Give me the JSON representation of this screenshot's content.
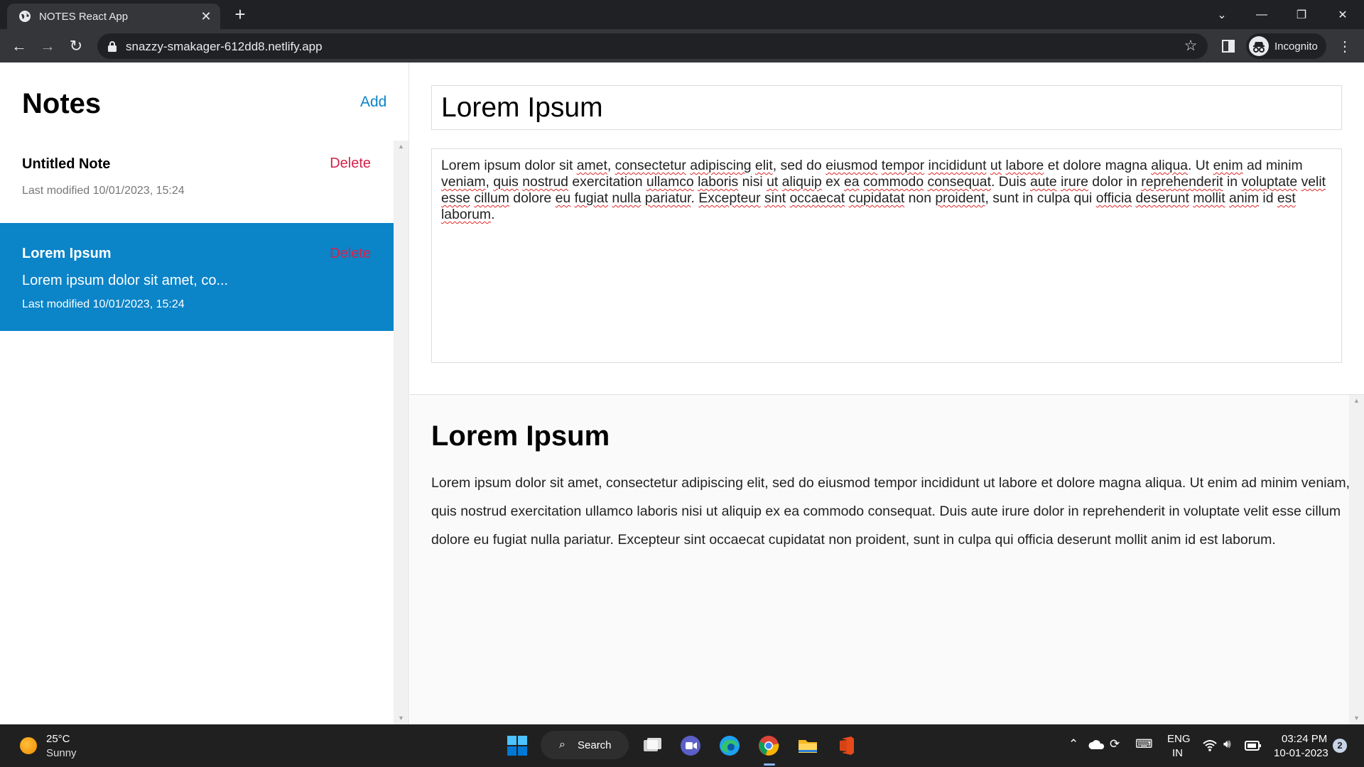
{
  "browser": {
    "tab_title": "NOTES React App",
    "url": "snazzy-smakager-612dd8.netlify.app",
    "profile_label": "Incognito"
  },
  "sidebar": {
    "title": "Notes",
    "add_label": "Add",
    "notes": [
      {
        "title": "Untitled Note",
        "delete_label": "Delete",
        "preview": "",
        "modified": "Last modified 10/01/2023, 15:24",
        "active": false
      },
      {
        "title": "Lorem Ipsum",
        "delete_label": "Delete",
        "preview": "Lorem ipsum dolor sit amet, co...",
        "modified": "Last modified 10/01/2023, 15:24",
        "active": true
      }
    ]
  },
  "editor": {
    "title_value": "Lorem Ipsum",
    "body_value": "Lorem ipsum dolor sit amet, consectetur adipiscing elit, sed do eiusmod tempor incididunt ut labore et dolore magna aliqua. Ut enim ad minim veniam, quis nostrud exercitation ullamco laboris nisi ut aliquip ex ea commodo consequat. Duis aute irure dolor in reprehenderit in voluptate velit esse cillum dolore eu fugiat nulla pariatur. Excepteur sint occaecat cupidatat non proident, sunt in culpa qui officia deserunt mollit anim id est laborum."
  },
  "preview": {
    "title": "Lorem Ipsum",
    "body": "Lorem ipsum dolor sit amet, consectetur adipiscing elit, sed do eiusmod tempor incididunt ut labore et dolore magna aliqua. Ut enim ad minim veniam, quis nostrud exercitation ullamco laboris nisi ut aliquip ex ea commodo consequat. Duis aute irure dolor in reprehenderit in voluptate velit esse cillum dolore eu fugiat nulla pariatur. Excepteur sint occaecat cupidatat non proident, sunt in culpa qui officia deserunt mollit anim id est laborum."
  },
  "taskbar": {
    "weather_temp": "25°C",
    "weather_desc": "Sunny",
    "search_label": "Search",
    "lang_line1": "ENG",
    "lang_line2": "IN",
    "time": "03:24 PM",
    "date": "10-01-2023",
    "notification_count": "2"
  },
  "colors": {
    "accent": "#0b84c8",
    "delete": "#d6224b",
    "chrome_dark": "#202124",
    "chrome_toolbar": "#35363a"
  },
  "icons": [
    "globe-icon",
    "close-icon",
    "plus-icon",
    "chevron-down-icon",
    "minimize-icon",
    "restore-icon",
    "back-icon",
    "forward-icon",
    "reload-icon",
    "lock-icon",
    "star-icon",
    "side-panel-icon",
    "incognito-icon",
    "more-icon",
    "windows-start-icon",
    "search-icon",
    "task-view-icon",
    "teams-icon",
    "edge-icon",
    "chrome-icon",
    "file-explorer-icon",
    "office-icon",
    "chevron-up-icon",
    "onedrive-icon",
    "sync-icon",
    "keyboard-icon",
    "wifi-icon",
    "volume-icon",
    "battery-icon"
  ]
}
